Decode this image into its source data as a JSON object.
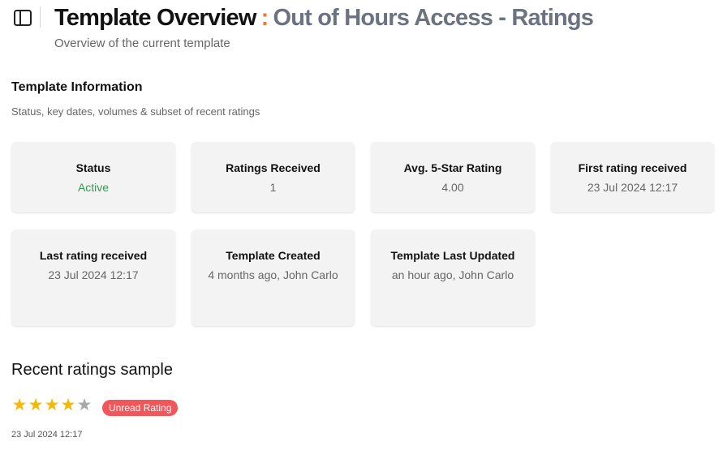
{
  "header": {
    "title": "Template Overview",
    "separator": ":",
    "template_name": "Out of Hours Access - Ratings",
    "subtitle": "Overview of the current template",
    "icons": {
      "sidebar_toggle": "sidebar-toggle-icon"
    }
  },
  "info": {
    "title": "Template Information",
    "description": "Status, key dates, volumes & subset of recent ratings",
    "cards": [
      {
        "label": "Status",
        "value": "Active",
        "value_color": "#2e9e4e"
      },
      {
        "label": "Ratings Received",
        "value": "1"
      },
      {
        "label": "Avg. 5-Star Rating",
        "value": "4.00"
      },
      {
        "label": "First rating received",
        "value": "23 Jul 2024 12:17"
      },
      {
        "label": "Last rating received",
        "value": "23 Jul 2024 12:17"
      },
      {
        "label": "Template Created",
        "value": "4 months ago, John Carlo"
      },
      {
        "label": "Template Last Updated",
        "value": "an hour ago, John Carlo"
      }
    ]
  },
  "recent": {
    "title": "Recent ratings sample",
    "ratings": [
      {
        "stars": 4,
        "max_stars": 5,
        "badge": "Unread Rating",
        "date": "23 Jul 2024 12:17"
      }
    ]
  },
  "colors": {
    "accent": "#f07b2c",
    "star_filled": "#f6b800",
    "star_empty": "#a8a8a8",
    "badge": "#f0565a",
    "card_bg": "#f3f3f3"
  }
}
